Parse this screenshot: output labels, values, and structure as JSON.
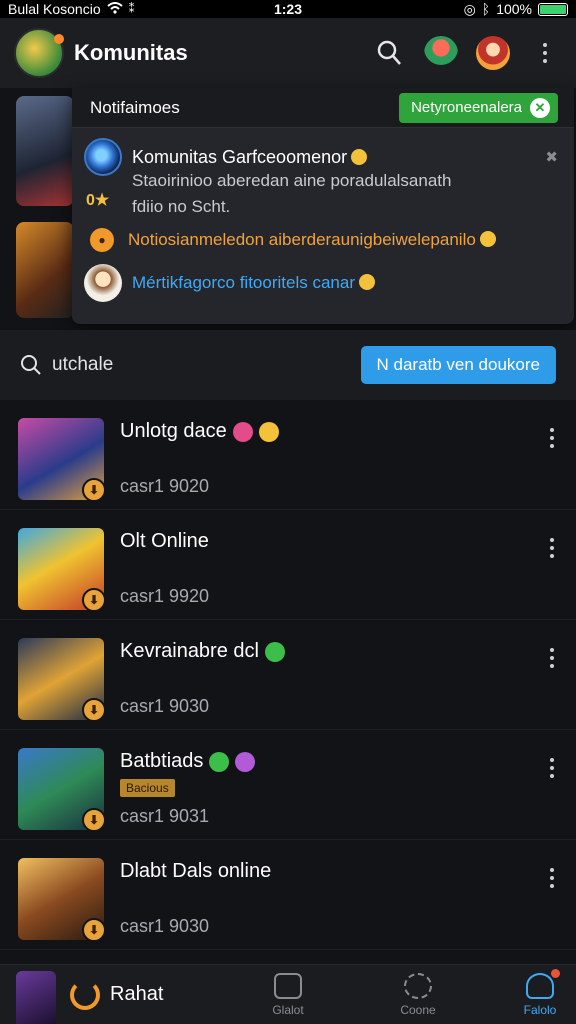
{
  "status": {
    "carrier": "Bulal Kosoncio",
    "clock": "1:23",
    "battery": "100%",
    "battery_level": 1.0
  },
  "appbar": {
    "title": "Komunitas"
  },
  "notifications": {
    "title": "Notifaimoes",
    "action": "Netyroneenalera",
    "items": [
      {
        "title": "Komunitas Garfceoomenor",
        "body1": "Staoirinioo aberedan aine poradulalsanath",
        "body2": "fdiio no Scht."
      },
      {
        "text": "Notiosianmeledon aiberderaunigbeiwelepanilo"
      },
      {
        "text": "Mértikfagorco fitooritels canar"
      }
    ],
    "coin_label": "0"
  },
  "search": {
    "value": "utchale",
    "cta": "N daratb ven doukore"
  },
  "games": [
    {
      "title": "Unlotg dace",
      "sub": "casr1 9020"
    },
    {
      "title": "Olt Online",
      "sub": "casr1 9920"
    },
    {
      "title": "Kevrainabre dcl",
      "sub": "casr1 9030"
    },
    {
      "title": "Batbtiads",
      "tag": "Bacious",
      "sub": "casr1 9031"
    },
    {
      "title": "Dlabt Dals online",
      "sub": "casr1 9030"
    }
  ],
  "bottom_nav": {
    "primary": "Rahat",
    "tabs": [
      "Glalot",
      "Coone",
      "Falolo"
    ]
  }
}
